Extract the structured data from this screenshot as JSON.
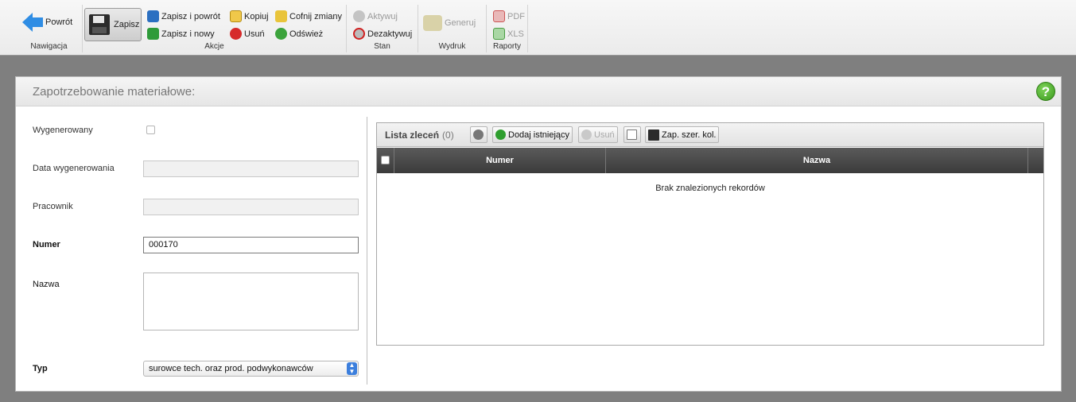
{
  "toolbar": {
    "nav": {
      "group_label": "Nawigacja",
      "back": "Powrót"
    },
    "actions": {
      "group_label": "Akcje",
      "save": "Zapisz",
      "save_and_back": "Zapisz i powrót",
      "save_and_new": "Zapisz i nowy",
      "copy": "Kopiuj",
      "delete": "Usuń",
      "undo": "Cofnij zmiany",
      "refresh": "Odśwież"
    },
    "state": {
      "group_label": "Stan",
      "activate": "Aktywuj",
      "deactivate": "Dezaktywuj"
    },
    "print": {
      "group_label": "Wydruk",
      "generate": "Generuj"
    },
    "reports": {
      "group_label": "Raporty",
      "pdf": "PDF",
      "xls": "XLS"
    }
  },
  "panel": {
    "title": "Zapotrzebowanie materiałowe:",
    "help": "?"
  },
  "form": {
    "generated_label": "Wygenerowany",
    "generated_checked": false,
    "generated_date_label": "Data wygenerowania",
    "generated_date_value": "",
    "employee_label": "Pracownik",
    "employee_value": "",
    "number_label": "Numer",
    "number_value": "000170",
    "name_label": "Nazwa",
    "name_value": "",
    "type_label": "Typ",
    "type_value": "surowce tech. oraz prod. podwykonawców"
  },
  "orders": {
    "title": "Lista zleceń",
    "count": "(0)",
    "add_existing": "Dodaj istniejący",
    "remove": "Usuń",
    "save_widths": "Zap. szer. kol.",
    "columns": [
      "Numer",
      "Nazwa"
    ],
    "empty_text": "Brak znalezionych rekordów"
  }
}
